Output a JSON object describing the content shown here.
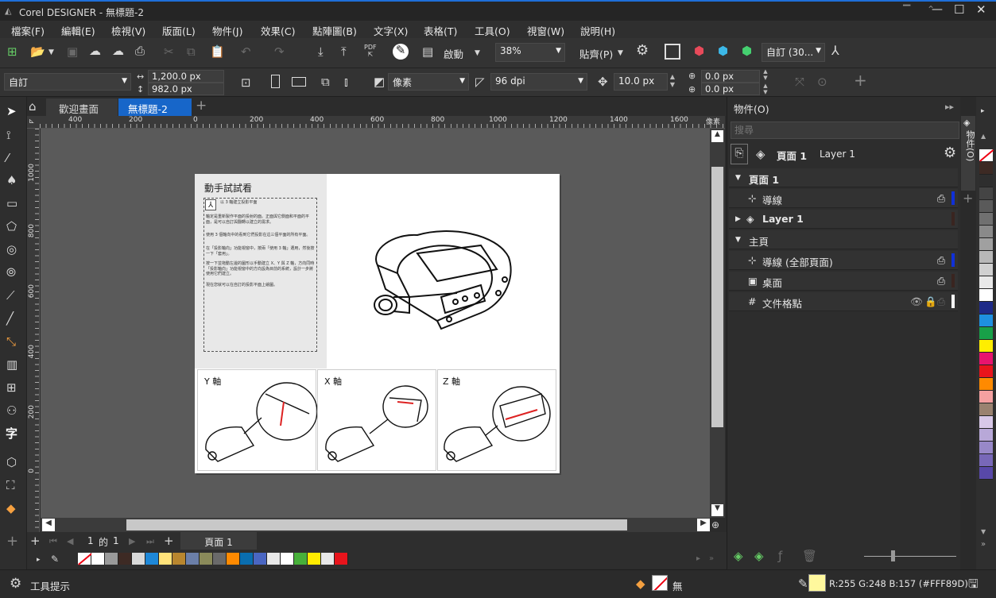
{
  "app": {
    "title": "Corel DESIGNER - 無標題-2"
  },
  "menu": [
    "檔案(F)",
    "編輯(E)",
    "檢視(V)",
    "版面(L)",
    "物件(J)",
    "效果(C)",
    "點陣圖(B)",
    "文字(X)",
    "表格(T)",
    "工具(O)",
    "視窗(W)",
    "說明(H)"
  ],
  "toolbar": {
    "snap_label": "啟動",
    "zoom": "38%",
    "paste_label": "貼齊(P)",
    "view_preset": "自訂 (30..."
  },
  "propbar": {
    "page_size": "自訂",
    "width": "1,200.0 px",
    "height": "982.0 px",
    "units": "像素",
    "resolution": "96 dpi",
    "nudge": "10.0 px",
    "dup_x": "0.0 px",
    "dup_y": "0.0 px"
  },
  "tabs": {
    "welcome": "歡迎畫面",
    "doc": "無標題-2"
  },
  "ruler": {
    "top_labels": [
      "400",
      "200",
      "0",
      "200",
      "400",
      "600",
      "800",
      "1000",
      "1200",
      "1400",
      "1600"
    ],
    "unit": "像素",
    "left_labels": [
      "1000",
      "800",
      "600",
      "400",
      "200",
      "0"
    ]
  },
  "document": {
    "heading": "動手試試看",
    "list_item": "以 3 軸建立投影平面",
    "para1": "軸定是重新製作平面的投射的面。正面與它側面和平面的平面，是可以自訂與翻轉以建立的需求。",
    "para2": "使用 3 個軸向中的看到它們投影在這三個平面的所有平面。",
    "para3": "在「投影軸向」功能視窗中，按兩「使用 3 軸」選用，然後按一下「套用」。",
    "para4": "按一下並拖動左邊的圖形以手動建立 X、Y 與 Z 軸，方向同時「投影軸向」功能視窗中的方向設為目前的系統，設計一步將使用它們建立。",
    "para5": "現在您就可以在自訂的投影平面上繪圖。",
    "axis_y": "Y 軸",
    "axis_x": "X 軸",
    "axis_z": "Z 軸"
  },
  "pagebar": {
    "current": "1",
    "of": "的",
    "total": "1",
    "page_tab": "頁面 1"
  },
  "palette": [
    "#ffffff",
    "#9a9a9a",
    "#3d2a24",
    "#d9d9d9",
    "#1e88d8",
    "#ffe27a",
    "#b8862e",
    "#6b7fa8",
    "#8a8a5a",
    "#6a6a6a",
    "#ff8a00",
    "#0a6eb0",
    "#4a66c2",
    "#e8e8e8",
    "#ffffff",
    "#47b03a",
    "#ffeb00",
    "#e8e8e8",
    "#e8141c"
  ],
  "docker": {
    "title": "物件(O)",
    "search_placeholder": "搜尋",
    "current_page": "頁面 1",
    "current_layer": "Layer 1",
    "rows": [
      {
        "label": "頁面 1",
        "kind": "page"
      },
      {
        "label": "導線",
        "kind": "layer",
        "color": "#1030d8"
      },
      {
        "label": "Layer 1",
        "kind": "layer",
        "color": "#3a2520"
      },
      {
        "label": "主頁",
        "kind": "page"
      },
      {
        "label": "導線 (全部頁面)",
        "kind": "layer",
        "color": "#1030d8"
      },
      {
        "label": "桌面",
        "kind": "layer",
        "color": "#3a2520"
      },
      {
        "label": "文件格點",
        "kind": "layer",
        "color": "#ffffff"
      }
    ],
    "side_tab": "物件(O)"
  },
  "right_palette": [
    "#ffffff",
    "#3d2a24",
    "#2e2e2e",
    "#444",
    "#5a5a5a",
    "#707070",
    "#8a8a8a",
    "#a0a0a0",
    "#b8b8b8",
    "#d0d0d0",
    "#e8e8e8",
    "#ffffff",
    "#1e2a88",
    "#1e90e0",
    "#18a048",
    "#ffee00",
    "#e8146e",
    "#e8141c",
    "#ff8a00",
    "#f4a0a0",
    "#9a8270",
    "#d8c8e8",
    "#b8a8d8",
    "#9888c8",
    "#7868b8",
    "#5848a8"
  ],
  "status": {
    "tooltip_label": "工具提示",
    "fill_label": "無",
    "color_readout": "R:255 G:248 B:157 (#FFF89D)",
    "fill_color": "#FFF89D"
  }
}
